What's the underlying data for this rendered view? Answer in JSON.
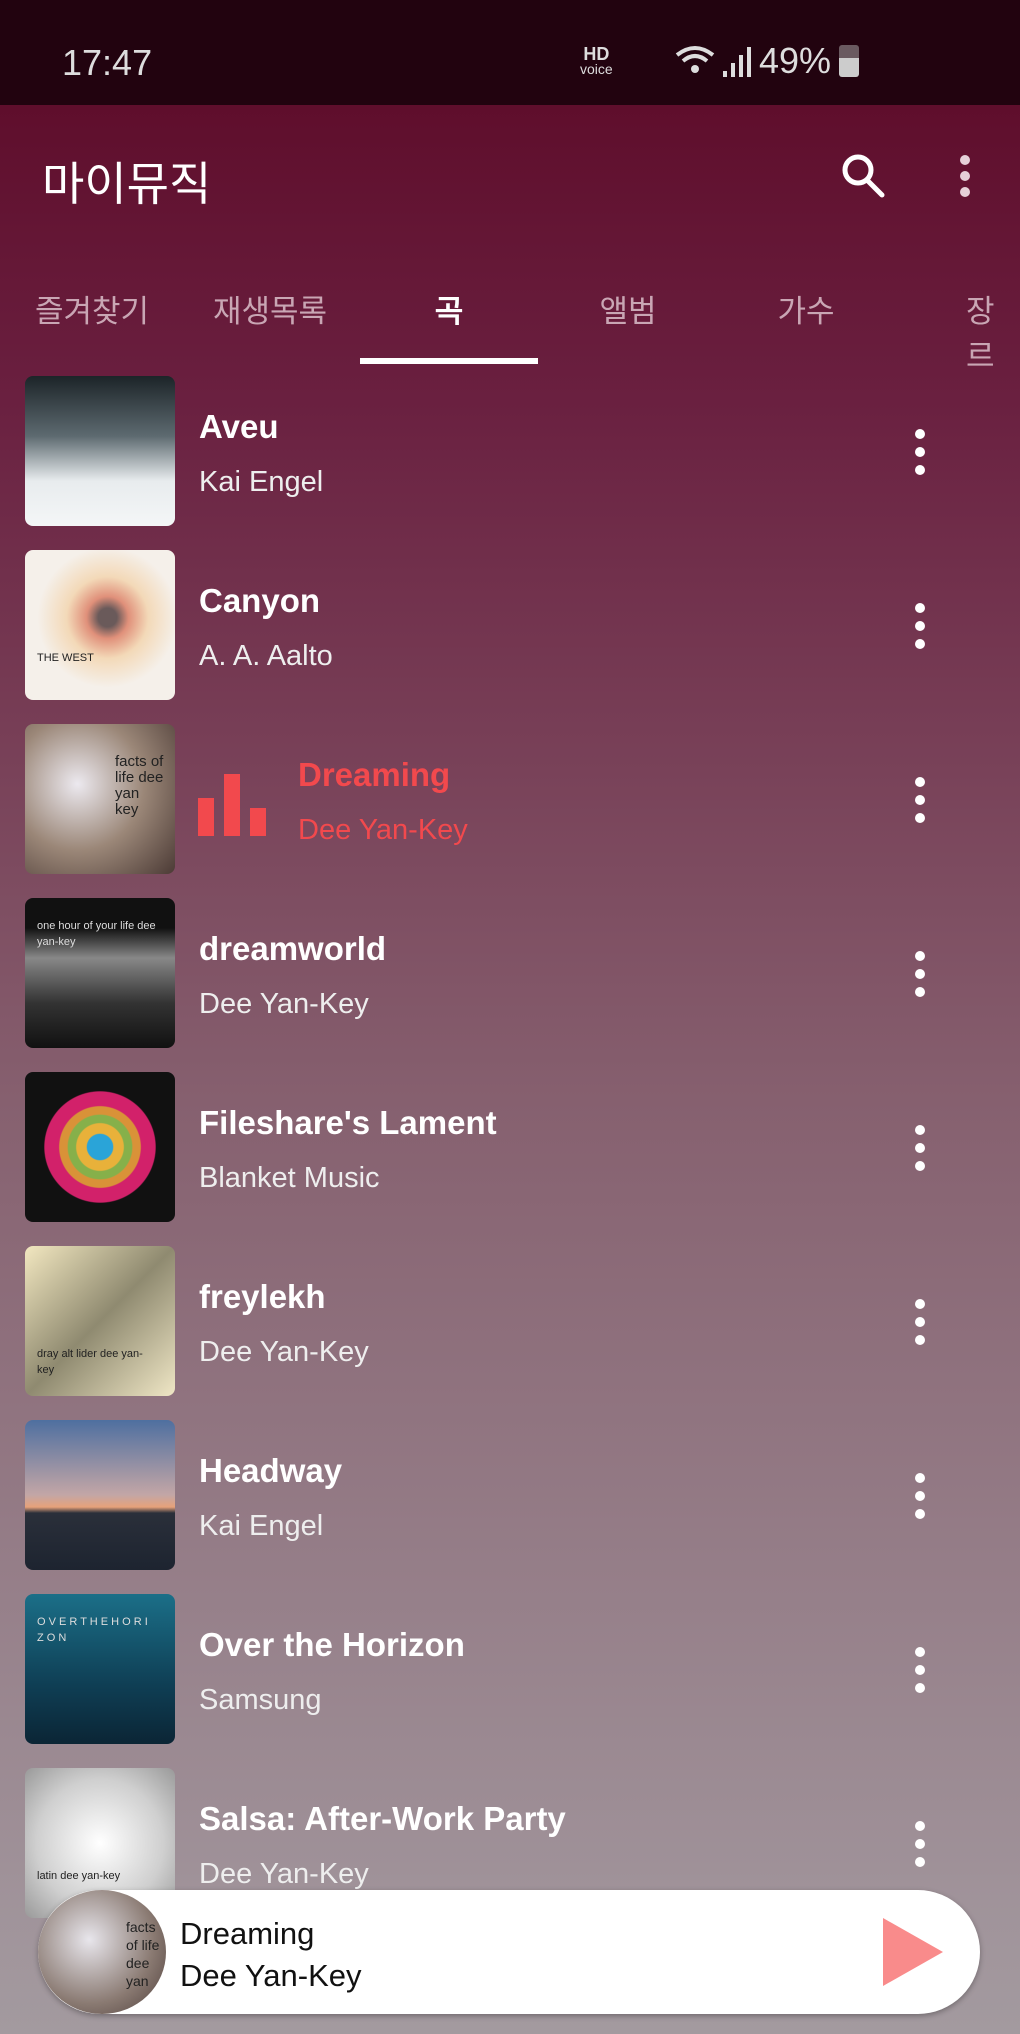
{
  "status_bar": {
    "time": "17:47",
    "hd": "HD",
    "voice": "voice",
    "battery": "49%"
  },
  "header": {
    "title": "마이뮤직"
  },
  "tabs": [
    {
      "label": "즐겨찾기"
    },
    {
      "label": "재생목록"
    },
    {
      "label": "곡",
      "active": true
    },
    {
      "label": "앨범"
    },
    {
      "label": "가수"
    },
    {
      "label": "장르"
    }
  ],
  "songs": [
    {
      "title": "Aveu",
      "artist": "Kai Engel",
      "art": "linear-gradient(180deg,#1c2428,#5d6a70 40%,#e8ecee 70%,#f4f6f7)"
    },
    {
      "title": "Canyon",
      "artist": "A. A. Aalto",
      "art": "radial-gradient(circle at 55% 45%,#6a5a5a 8%,#e0907a 18%,#f3d9b8 35%,#f5f0ea 60%)",
      "caption": "THE WEST"
    },
    {
      "title": "Dreaming",
      "artist": "Dee Yan-Key",
      "playing": true,
      "art": "radial-gradient(circle at 35% 40%,#ece9ef,#9b8778 50%,#4b3a35)",
      "caption": "facts of life dee yan key"
    },
    {
      "title": "dreamworld",
      "artist": "Dee Yan-Key",
      "art": "linear-gradient(180deg,#111 20%,#888 40%,#333 70%,#111)",
      "caption": "one hour of your life dee yan-key"
    },
    {
      "title": "Fileshare's Lament",
      "artist": "Blanket Music",
      "art": "radial-gradient(circle,#2aa4d8 12%,#e8b13a 13% 22%,#86b04a 23% 30%,#d99238 31% 38%,#d2216a 39% 52%,#111 53%)"
    },
    {
      "title": "freylekh",
      "artist": "Dee Yan-Key",
      "art": "linear-gradient(135deg,#f2e7c0,#8f8a70 50%,#efe6c5)",
      "caption": "dray alt lider dee yan-key"
    },
    {
      "title": "Headway",
      "artist": "Kai Engel",
      "art": "linear-gradient(180deg,#4e6fa0,#c3a6a6 50%,#e7a27a 58%,#2a2f3a 62%,#1d2430)"
    },
    {
      "title": "Over the Horizon",
      "artist": "Samsung",
      "art": "linear-gradient(180deg,#1b6f88,#0f3f55 60%,#0b2535)",
      "caption": "O V E R  T H E  H O R I Z O N"
    },
    {
      "title": "Salsa: After-Work Party",
      "artist": "Dee Yan-Key",
      "art": "radial-gradient(circle at 50% 50%,#fff,#cfcfcf 60%,#999)",
      "caption": "latin dee yan-key"
    }
  ],
  "now_playing": {
    "title": "Dreaming",
    "artist": "Dee Yan-Key",
    "art_caption": "facts of life dee yan"
  },
  "colors": {
    "accent": "#f2494d",
    "play_button": "#f98b8b",
    "status_bar": "#22030f",
    "header": "#5f0e2c"
  }
}
